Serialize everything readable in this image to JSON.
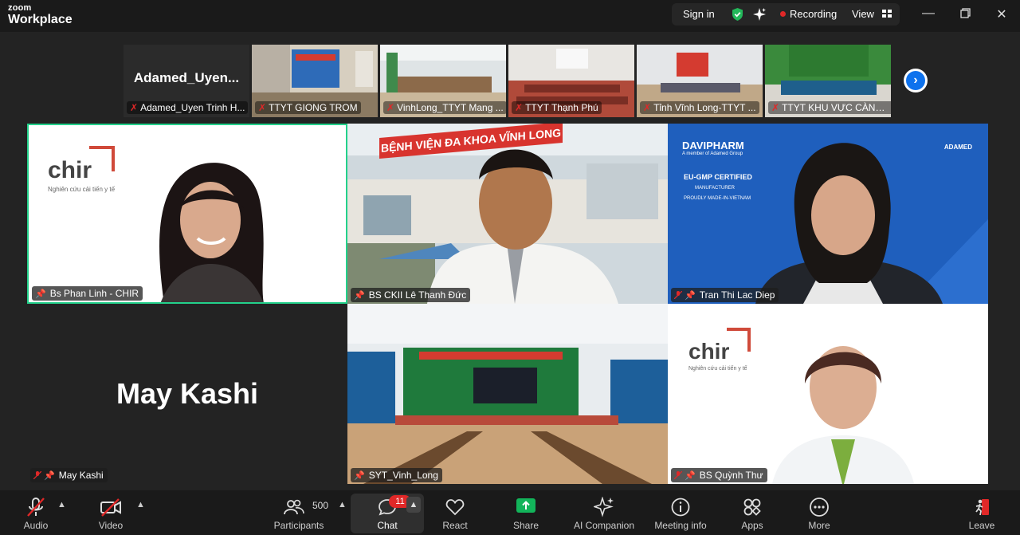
{
  "app": {
    "brand_top": "zoom",
    "brand_bottom": "Workplace"
  },
  "titlebar": {
    "sign_in": "Sign in",
    "recording": "Recording",
    "view": "View"
  },
  "strip": [
    {
      "name": "Adamed_Uyen Trinh H...",
      "display": "Adamed_Uyen..."
    },
    {
      "name": "TTYT GIONG TROM"
    },
    {
      "name": "VinhLong_TTYT Mang ..."
    },
    {
      "name": "TTYT Thạnh Phú"
    },
    {
      "name": "Tỉnh Vĩnh Long-TTYT ..."
    },
    {
      "name": "TTYT KHU VỰC CÀNG ..."
    }
  ],
  "gallery": [
    {
      "name": "Bs Phan Linh - CHIR",
      "logo": "chir",
      "logo_sub": "Nghiên cứu cải tiến y tế"
    },
    {
      "name": "BS CKII Lê Thanh Đức",
      "sign": "BỆNH VIỆN ĐA KHOA VĨNH LONG"
    },
    {
      "name": "Tran Thi Lac Diep",
      "brand": "DAVIPHARM",
      "brand_sub": "A member of Adamed Group",
      "adamed": "ADAMED",
      "cert": "EU-GMP CERTIFIED",
      "manufacturer": "MANUFACTURER",
      "made": "PROUDLY MADE-IN-VIETNAM"
    },
    {
      "name": "May Kashi",
      "display": "May Kashi"
    },
    {
      "name": "SYT_Vinh_Long"
    },
    {
      "name": "BS Quỳnh Thư",
      "logo": "chir",
      "logo_sub": "Nghiên cứu cải tiến y tế"
    }
  ],
  "toolbar": {
    "audio": "Audio",
    "video": "Video",
    "participants": "Participants",
    "participant_count": "500",
    "chat": "Chat",
    "chat_badge": "11",
    "react": "React",
    "share": "Share",
    "ai_companion": "AI Companion",
    "meeting_info": "Meeting info",
    "apps": "Apps",
    "more": "More",
    "leave": "Leave"
  },
  "colors": {
    "accent": "#0e72ed",
    "share": "#12b45a",
    "active_speaker": "#23d18b",
    "muted": "#e02828",
    "badge": "#e02828"
  }
}
